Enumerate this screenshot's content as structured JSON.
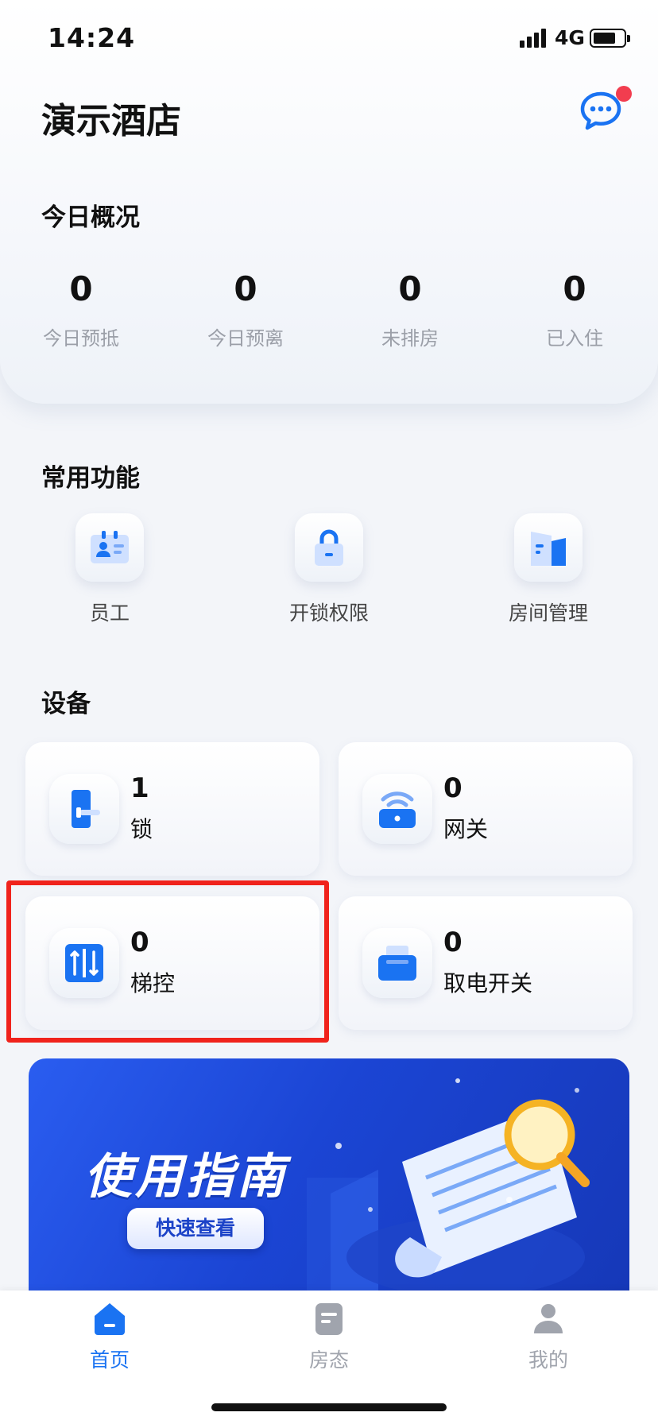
{
  "status_bar": {
    "time": "14:24",
    "network": "4G"
  },
  "header": {
    "hotel_name": "演示酒店",
    "message_icon": "chat-bubble-icon",
    "has_unread": true
  },
  "overview": {
    "title": "今日概况",
    "stats": [
      {
        "value": "0",
        "label": "今日预抵"
      },
      {
        "value": "0",
        "label": "今日预离"
      },
      {
        "value": "0",
        "label": "未排房"
      },
      {
        "value": "0",
        "label": "已入住"
      }
    ]
  },
  "functions": {
    "title": "常用功能",
    "items": [
      {
        "label": "员工",
        "icon": "staff-card-icon"
      },
      {
        "label": "开锁权限",
        "icon": "padlock-icon"
      },
      {
        "label": "房间管理",
        "icon": "building-icon"
      }
    ]
  },
  "devices": {
    "title": "设备",
    "items": [
      {
        "count": "1",
        "label": "锁",
        "icon": "door-lock-icon"
      },
      {
        "count": "0",
        "label": "网关",
        "icon": "wifi-gateway-icon"
      },
      {
        "count": "0",
        "label": "梯控",
        "icon": "elevator-icon"
      },
      {
        "count": "0",
        "label": "取电开关",
        "icon": "power-card-switch-icon"
      }
    ]
  },
  "banner": {
    "title": "使用指南",
    "button": "快速查看"
  },
  "tabbar": {
    "items": [
      {
        "label": "首页",
        "icon": "home-icon",
        "active": true
      },
      {
        "label": "房态",
        "icon": "room-status-icon",
        "active": false
      },
      {
        "label": "我的",
        "icon": "user-icon",
        "active": false
      }
    ]
  },
  "colors": {
    "accent": "#1a73f2",
    "highlight": "#f0231c",
    "badge": "#f23d4f"
  }
}
